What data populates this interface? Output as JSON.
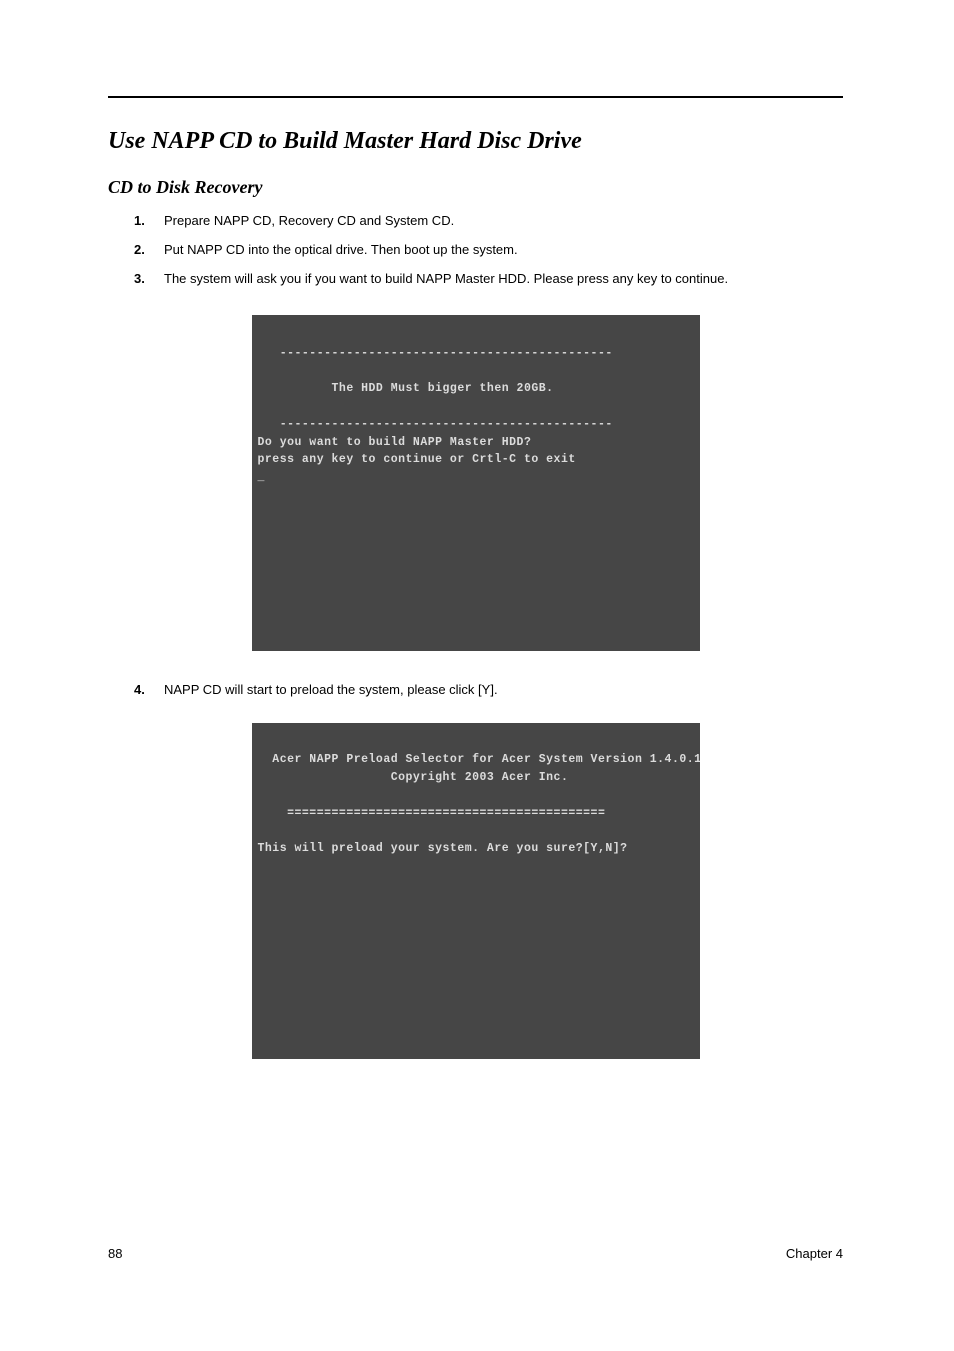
{
  "headings": {
    "h1": "Use NAPP CD to Build Master Hard Disc Drive",
    "h2": "CD to Disk Recovery"
  },
  "steps": [
    {
      "num": "1.",
      "text": "Prepare NAPP CD, Recovery CD and System CD."
    },
    {
      "num": "2.",
      "text": "Put NAPP CD into the optical drive. Then boot up the system."
    },
    {
      "num": "3.",
      "text": "The system will ask you if you want to build NAPP Master HDD. Please press any key to continue."
    },
    {
      "num": "4.",
      "text": "NAPP CD will start to preload the system, please click [Y]."
    }
  ],
  "terminal1": {
    "sep": "   ---------------------------------------------",
    "line1": "          The HDD Must bigger then 20GB.",
    "line2": "Do you want to build NAPP Master HDD?",
    "line3": "press any key to continue or Crtl-C to exit",
    "cursor": "_"
  },
  "terminal2": {
    "line1": "  Acer NAPP Preload Selector for Acer System Version 1.4.0.1",
    "line2": "                  Copyright 2003 Acer Inc.",
    "sep": "    ===========================================",
    "line3": "This will preload your system. Are you sure?[Y,N]?"
  },
  "footer": {
    "page_number": "88",
    "chapter": "Chapter 4"
  }
}
